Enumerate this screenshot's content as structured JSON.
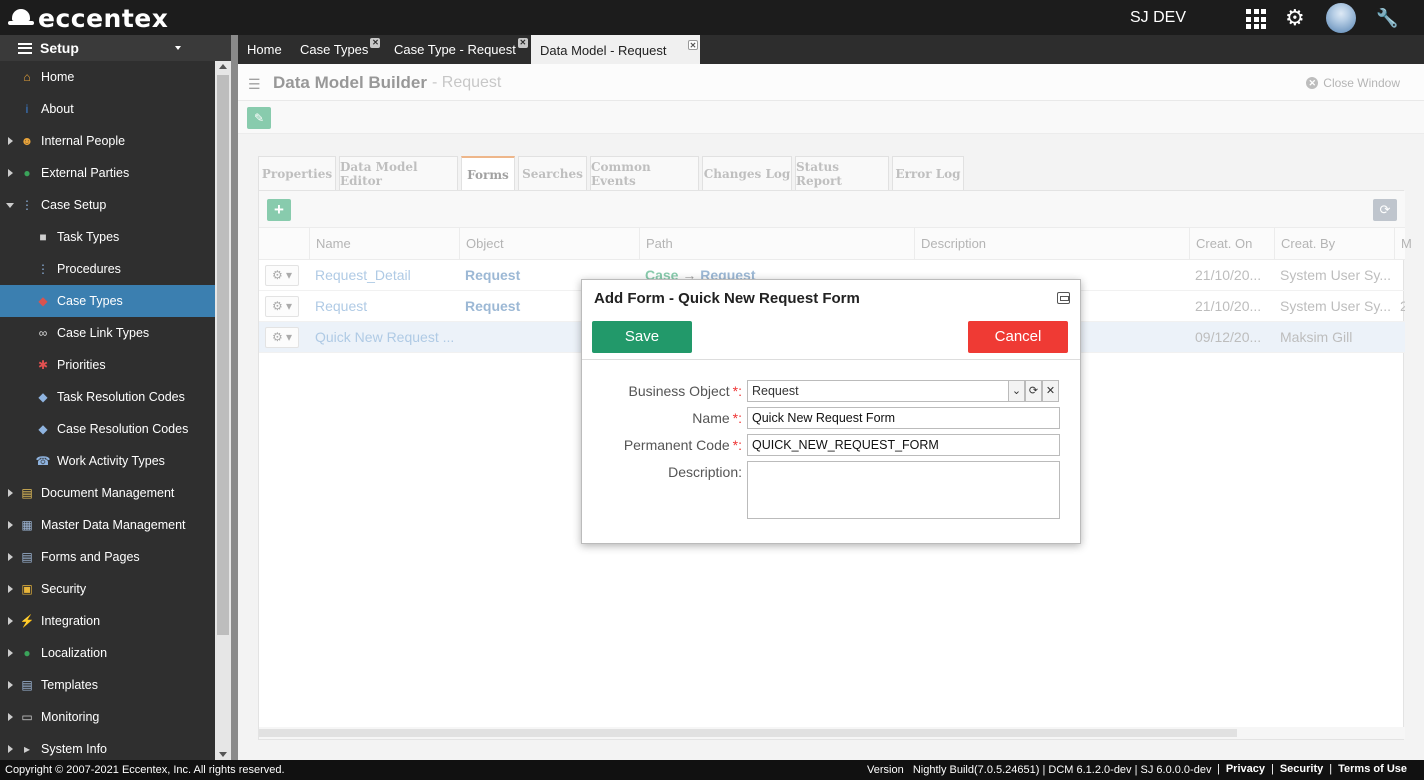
{
  "app": {
    "logo_text": "eccentex",
    "user": "SJ DEV"
  },
  "sidebar": {
    "title": "Setup",
    "items": [
      {
        "label": "Home",
        "icon": "home-icon",
        "level": 1
      },
      {
        "label": "About",
        "icon": "info-icon",
        "level": 1
      },
      {
        "label": "Internal People",
        "icon": "people-icon",
        "level": 1,
        "expandable": true
      },
      {
        "label": "External Parties",
        "icon": "globe-icon",
        "level": 1,
        "expandable": true
      },
      {
        "label": "Case Setup",
        "icon": "case-setup-icon",
        "level": 1,
        "expanded": true
      },
      {
        "label": "Task Types",
        "icon": "task-types-icon",
        "level": 2
      },
      {
        "label": "Procedures",
        "icon": "procedures-icon",
        "level": 2
      },
      {
        "label": "Case Types",
        "icon": "case-types-icon",
        "level": 2,
        "active": true
      },
      {
        "label": "Case Link Types",
        "icon": "link-icon",
        "level": 2
      },
      {
        "label": "Priorities",
        "icon": "priorities-icon",
        "level": 2
      },
      {
        "label": "Task Resolution Codes",
        "icon": "tag-icon",
        "level": 2
      },
      {
        "label": "Case Resolution Codes",
        "icon": "tag-icon",
        "level": 2
      },
      {
        "label": "Work Activity Types",
        "icon": "phone-icon",
        "level": 2
      },
      {
        "label": "Document Management",
        "icon": "folder-icon",
        "level": 1,
        "expandable": true
      },
      {
        "label": "Master Data Management",
        "icon": "table-icon",
        "level": 1,
        "expandable": true
      },
      {
        "label": "Forms and Pages",
        "icon": "form-icon",
        "level": 1,
        "expandable": true
      },
      {
        "label": "Security",
        "icon": "lock-icon",
        "level": 1,
        "expandable": true
      },
      {
        "label": "Integration",
        "icon": "integration-icon",
        "level": 1,
        "expandable": true
      },
      {
        "label": "Localization",
        "icon": "globe-icon",
        "level": 1,
        "expandable": true
      },
      {
        "label": "Templates",
        "icon": "template-icon",
        "level": 1,
        "expandable": true
      },
      {
        "label": "Monitoring",
        "icon": "monitor-icon",
        "level": 1,
        "expandable": true
      },
      {
        "label": "System Info",
        "icon": "terminal-icon",
        "level": 1,
        "expandable": true
      }
    ]
  },
  "tabs": [
    {
      "label": "Home"
    },
    {
      "label": "Case Types",
      "closable": true
    },
    {
      "label": "Case Type - Request",
      "closable": true
    },
    {
      "label": "Data Model - Request",
      "closable": true,
      "active": true
    }
  ],
  "page": {
    "title": "Data Model Builder",
    "subtitle": "- Request",
    "close_label": "Close Window"
  },
  "inner_tabs": [
    "Properties",
    "Data Model Editor",
    "Forms",
    "Searches",
    "Common Events",
    "Changes Log",
    "Status Report",
    "Error Log"
  ],
  "active_inner_tab": "Forms",
  "grid": {
    "columns": [
      "Name",
      "Object",
      "Path",
      "Description",
      "Creat. On",
      "Creat. By",
      "M"
    ],
    "rows": [
      {
        "name": "Request_Detail",
        "object": "Request",
        "path_from": "Case",
        "path_arrow": "→",
        "path_to": "Request",
        "created_on": "21/10/20...",
        "created_by": "System User Sy...",
        "extra": ""
      },
      {
        "name": "Request",
        "object": "Request",
        "path_from": "",
        "path_arrow": "",
        "path_to": "",
        "created_on": "21/10/20...",
        "created_by": "System User Sy...",
        "extra": "2"
      },
      {
        "name": "Quick New Request ...",
        "object": "",
        "path_from": "",
        "path_arrow": "",
        "path_to": "",
        "created_on": "09/12/20...",
        "created_by": "Maksim Gill",
        "extra": ""
      }
    ]
  },
  "modal": {
    "title": "Add Form - Quick New Request Form",
    "save_label": "Save",
    "cancel_label": "Cancel",
    "fields": {
      "business_object": {
        "label": "Business Object",
        "value": "Request",
        "required": "*:"
      },
      "name": {
        "label": "Name",
        "value": "Quick New Request Form",
        "required": "*:"
      },
      "permanent_code": {
        "label": "Permanent Code",
        "value": "QUICK_NEW_REQUEST_FORM",
        "required": "*:"
      },
      "description": {
        "label": "Description:",
        "value": ""
      }
    }
  },
  "footer": {
    "copyright": "Copyright © 2007-2021 Eccentex, Inc. All rights reserved.",
    "version": "Version   Nightly Build(7.0.5.24651) | DCM 6.1.2.0-dev | SJ 6.0.0.0-dev",
    "links": [
      "Privacy",
      "Security",
      "Terms of Use"
    ]
  },
  "colors": {
    "accent": "#3b7fb0",
    "save": "#22996a",
    "cancel": "#ef3a34",
    "active_tab_border": "#e07a2b"
  }
}
